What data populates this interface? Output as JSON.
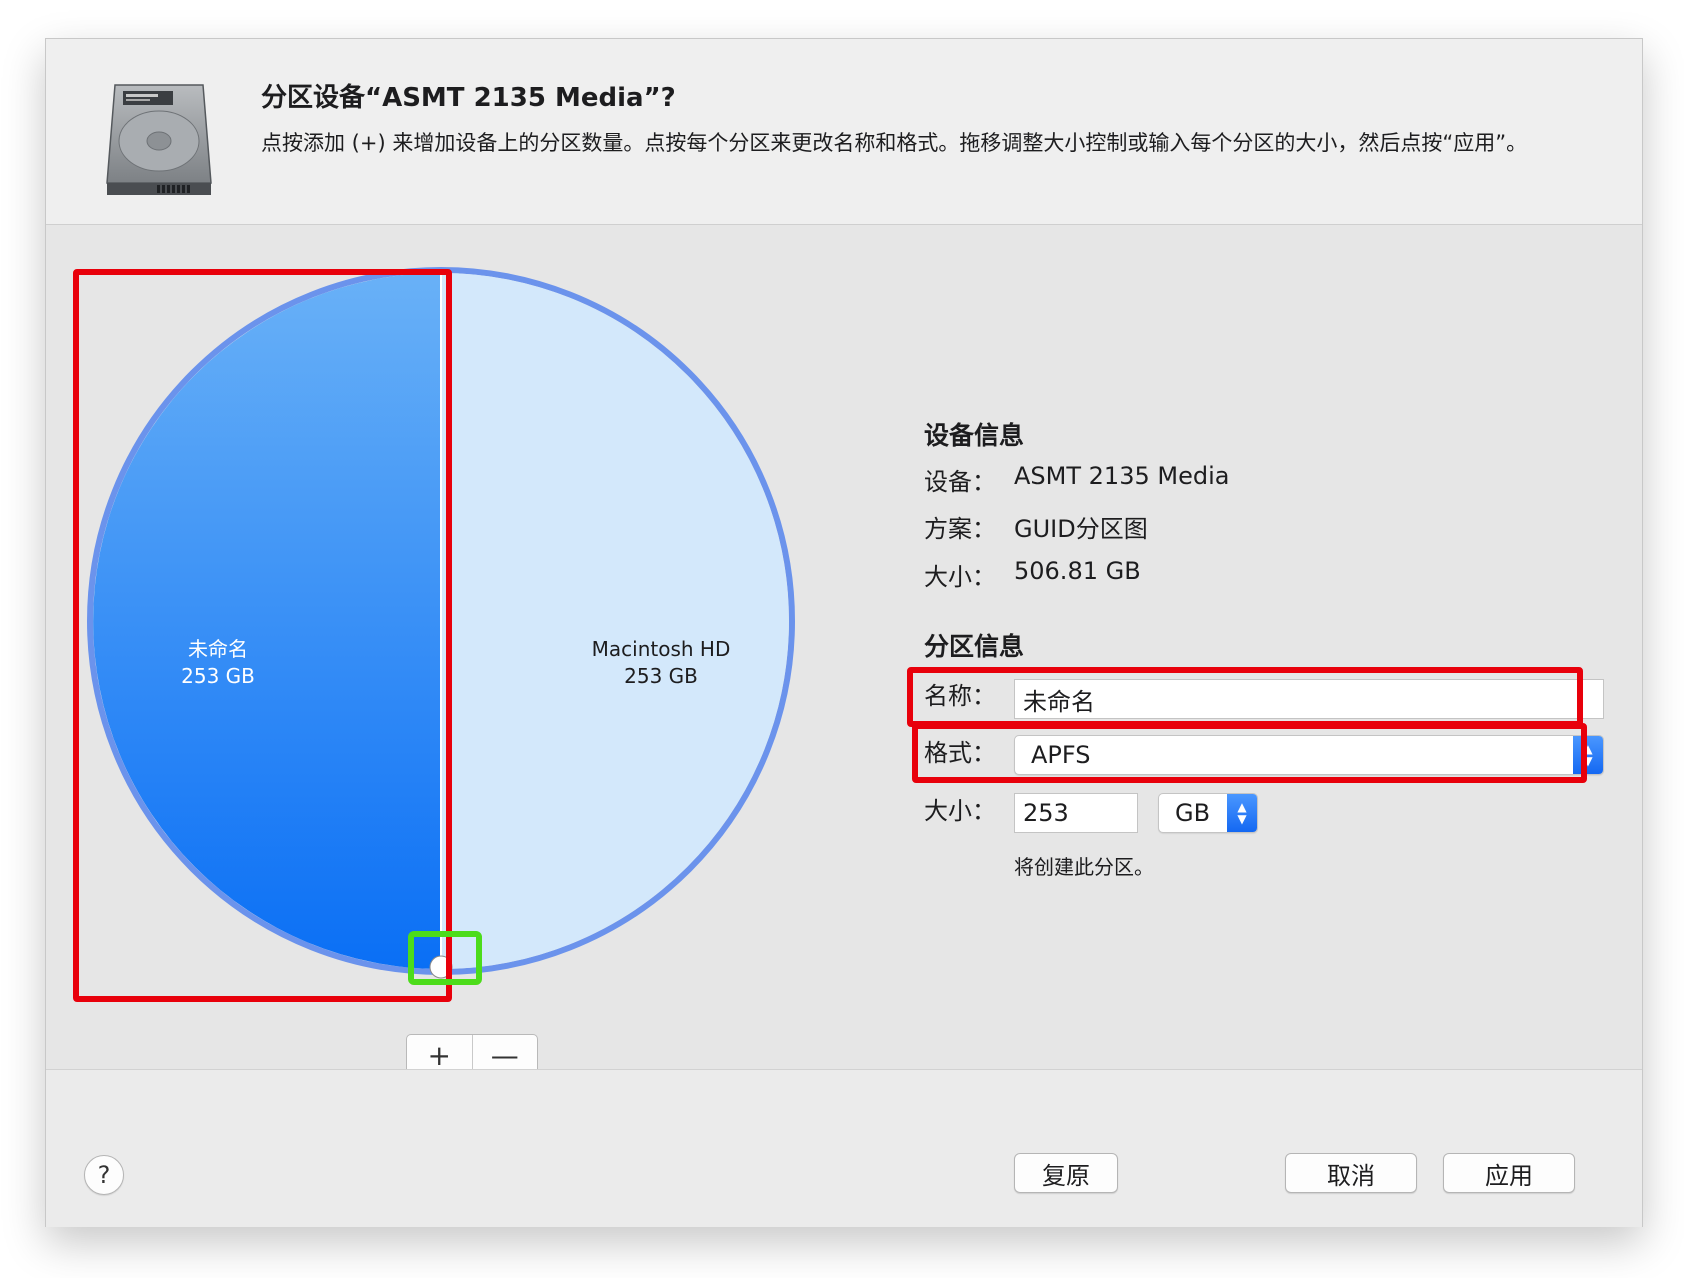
{
  "dialog": {
    "title": "分区设备“ASMT 2135 Media”?",
    "subtitle": "点按添加 (+) 来增加设备上的分区数量。点按每个分区来更改名称和格式。拖移调整大小控制或输入每个分区的大小，然后点按“应用”。",
    "icon": "hard-disk-icon"
  },
  "chart_data": {
    "type": "pie",
    "slices": [
      {
        "name": "未命名",
        "size_label": "253 GB",
        "value": 253,
        "color": "#1a7cf5"
      },
      {
        "name": "Macintosh HD",
        "size_label": "253 GB",
        "value": 253,
        "color": "#d3e8fb"
      }
    ]
  },
  "pie_controls": {
    "add_label": "+",
    "remove_label": "—"
  },
  "device_info": {
    "heading": "设备信息",
    "device_label": "设备：",
    "device_value": "ASMT 2135 Media",
    "scheme_label": "方案：",
    "scheme_value": "GUID分区图",
    "size_label": "大小：",
    "size_value": "506.81 GB"
  },
  "partition_info": {
    "heading": "分区信息",
    "name_label": "名称：",
    "name_value": "未命名",
    "format_label": "格式：",
    "format_value": "APFS",
    "size_label": "大小：",
    "size_value": "253",
    "unit_value": "GB",
    "note": "将创建此分区。"
  },
  "footer": {
    "help_label": "?",
    "revert_label": "复原",
    "cancel_label": "取消",
    "apply_label": "应用"
  },
  "colors": {
    "accent": "#1a7cf5",
    "highlight_red": "#e8000b",
    "highlight_green": "#4cdc1b"
  }
}
